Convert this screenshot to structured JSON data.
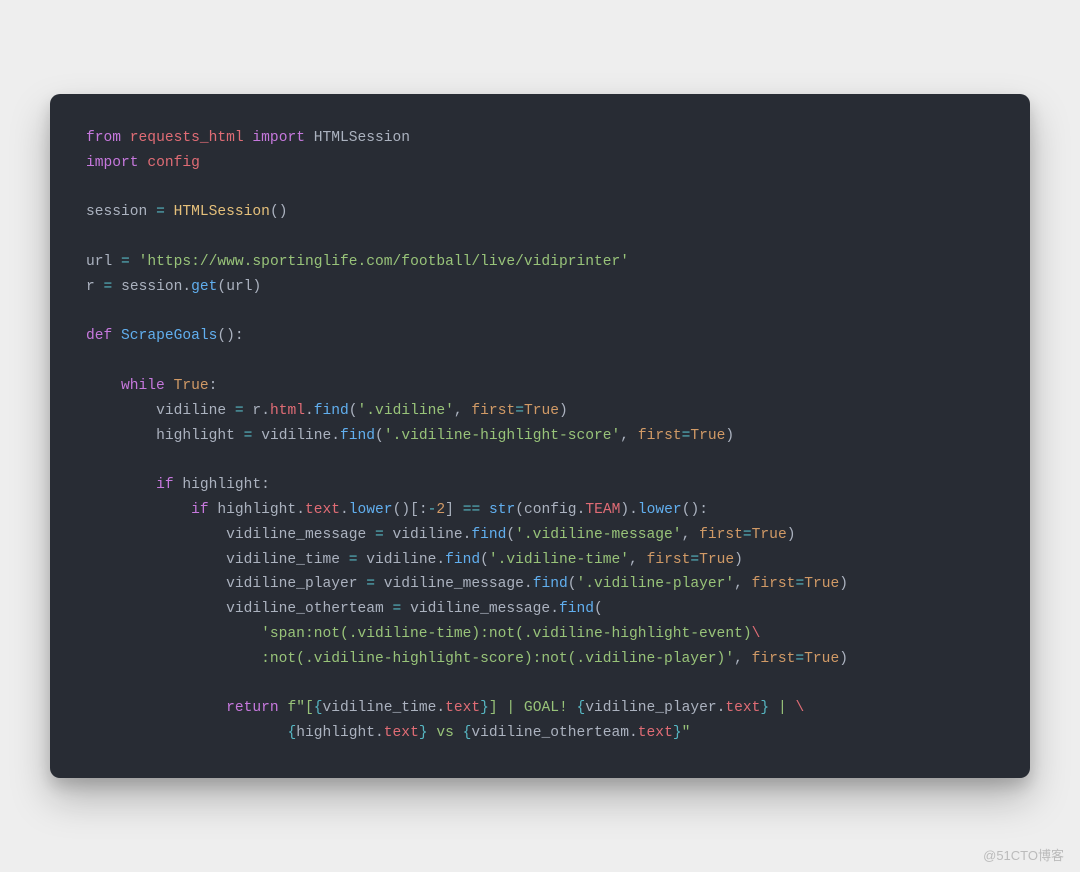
{
  "code": {
    "line1": {
      "from": "from",
      "module": "requests_html",
      "import": "import",
      "item": "HTMLSession"
    },
    "line2": {
      "import": "import",
      "module": "config"
    },
    "line3": "",
    "line4": {
      "lhs": "session",
      "eq": "=",
      "cls": "HTMLSession",
      "lp": "(",
      "rp": ")"
    },
    "line5": "",
    "line6": {
      "lhs": "url",
      "eq": "=",
      "str": "'https://www.sportinglife.com/football/live/vidiprinter'"
    },
    "line7": {
      "lhs": "r",
      "eq": "=",
      "obj": "session",
      "dot": ".",
      "fn": "get",
      "lp": "(",
      "arg": "url",
      "rp": ")"
    },
    "line8": "",
    "line9": {
      "def": "def",
      "name": "ScrapeGoals",
      "lp": "(",
      "rp": "):",
      "colon": ""
    },
    "line10": "",
    "line11": {
      "indent": "    ",
      "while": "while",
      "true": "True",
      "colon": ":"
    },
    "line12": {
      "indent": "        ",
      "lhs": "vidiline",
      "eq": "=",
      "r": "r",
      "d1": ".",
      "html": "html",
      "d2": ".",
      "fn": "find",
      "lp": "(",
      "str": "'.vidiline'",
      "comma": ",",
      "prm": "first",
      "peq": "=",
      "val": "True",
      "rp": ")"
    },
    "line13": {
      "indent": "        ",
      "lhs": "highlight",
      "eq": "=",
      "obj": "vidiline",
      "dot": ".",
      "fn": "find",
      "lp": "(",
      "str": "'.vidiline-highlight-score'",
      "comma": ",",
      "prm": "first",
      "peq": "=",
      "val": "True",
      "rp": ")"
    },
    "line14": "",
    "line15": {
      "indent": "        ",
      "if": "if",
      "cond": "highlight",
      "colon": ":"
    },
    "line16": {
      "indent": "            ",
      "if": "if",
      "obj": "highlight",
      "d1": ".",
      "text": "text",
      "d2": ".",
      "lower": "lower",
      "lp1": "(",
      "rp1": ")",
      "lb": "[",
      "colon_slice": ":",
      "neg": "-",
      "two": "2",
      "rb": "]",
      "eqeq": "==",
      "str_fn": "str",
      "lp2": "(",
      "cfg": "config",
      "d3": ".",
      "team": "TEAM",
      "rp2": ")",
      "d4": ".",
      "lower2": "lower",
      "lp3": "(",
      "rp3": ")",
      "end": ":"
    },
    "line17": {
      "indent": "                ",
      "lhs": "vidiline_message",
      "eq": "=",
      "obj": "vidiline",
      "dot": ".",
      "fn": "find",
      "lp": "(",
      "str": "'.vidiline-message'",
      "comma": ",",
      "prm": "first",
      "peq": "=",
      "val": "True",
      "rp": ")"
    },
    "line18": {
      "indent": "                ",
      "lhs": "vidiline_time",
      "eq": "=",
      "obj": "vidiline",
      "dot": ".",
      "fn": "find",
      "lp": "(",
      "str": "'.vidiline-time'",
      "comma": ",",
      "prm": "first",
      "peq": "=",
      "val": "True",
      "rp": ")"
    },
    "line19": {
      "indent": "                ",
      "lhs": "vidiline_player",
      "eq": "=",
      "obj": "vidiline_message",
      "dot": ".",
      "fn": "find",
      "lp": "(",
      "str": "'.vidiline-player'",
      "comma": ",",
      "prm": "first",
      "peq": "=",
      "val": "True",
      "rp": ")"
    },
    "line20": {
      "indent": "                ",
      "lhs": "vidiline_otherteam",
      "eq": "=",
      "obj": "vidiline_message",
      "dot": ".",
      "fn": "find",
      "lp": "("
    },
    "line21": {
      "indent": "                    ",
      "str": "'span:not(.vidiline-time):not(.vidiline-highlight-event)",
      "bs": "\\"
    },
    "line22": {
      "indent": "                    ",
      "str": ":not(.vidiline-highlight-score):not(.vidiline-player)'",
      "comma": ",",
      "prm": "first",
      "peq": "=",
      "val": "True",
      "rp": ")"
    },
    "line23": "",
    "line24": {
      "indent": "                ",
      "return": "return",
      "fpre": "f\"[",
      "lb": "{",
      "v1": "vidiline_time",
      "d1": ".",
      "t1": "text",
      "rb": "}",
      "mid1": "] | GOAL! ",
      "lb2": "{",
      "v2": "vidiline_player",
      "d2": ".",
      "t2": "text",
      "rb2": "}",
      "mid2": " | ",
      "bs": "\\"
    },
    "line25": {
      "indent": "                       ",
      "lb": "{",
      "v1": "highlight",
      "d1": ".",
      "t1": "text",
      "rb": "}",
      "mid": " vs ",
      "lb2": "{",
      "v2": "vidiline_otherteam",
      "d2": ".",
      "t2": "text",
      "rb2": "}",
      "end": "\""
    }
  },
  "watermark": "@51CTO博客"
}
